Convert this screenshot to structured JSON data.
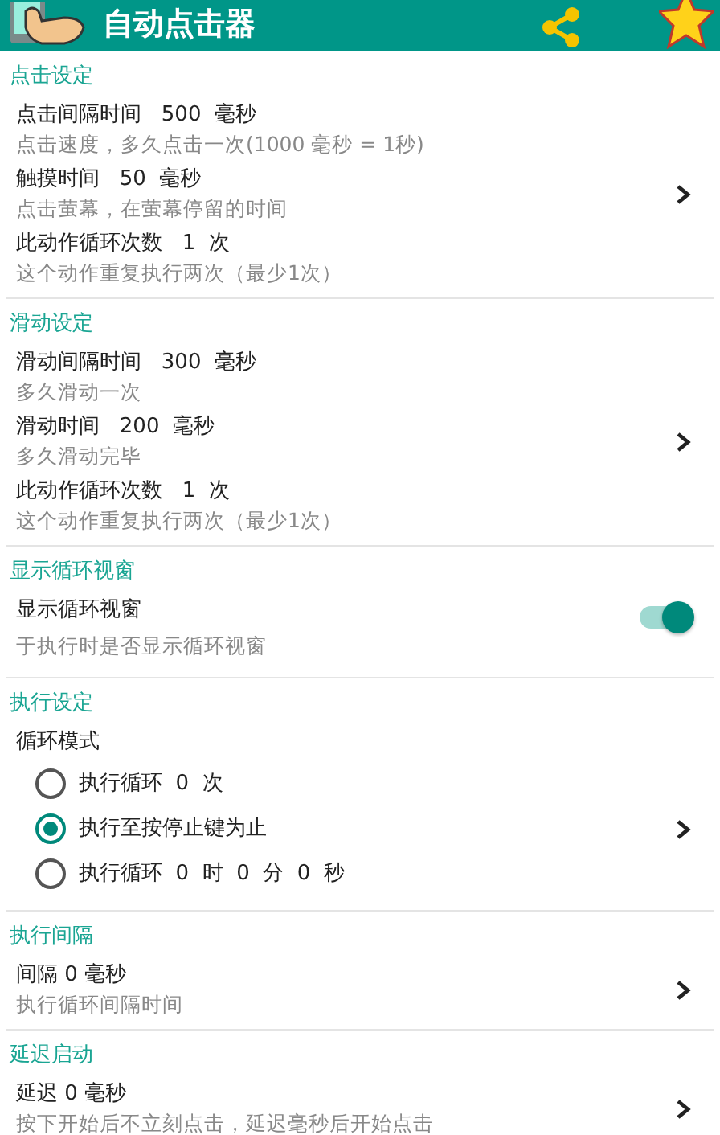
{
  "app_bar": {
    "title": "自动点击器"
  },
  "sections": [
    {
      "kind": "group",
      "header": "点击设定",
      "items": [
        {
          "title": "点击间隔时间   500  毫秒",
          "subtitle": "点击速度，多久点击一次(1000 毫秒 = 1秒)"
        },
        {
          "title": "触摸时间   50  毫秒",
          "subtitle": "点击萤幕，在萤幕停留的时间"
        },
        {
          "title": "此动作循环次数   1  次",
          "subtitle": "这个动作重复执行两次（最少1次）"
        }
      ]
    },
    {
      "kind": "group",
      "header": "滑动设定",
      "items": [
        {
          "title": "滑动间隔时间   300  毫秒",
          "subtitle": "多久滑动一次"
        },
        {
          "title": "滑动时间   200  毫秒",
          "subtitle": "多久滑动完毕"
        },
        {
          "title": "此动作循环次数   1  次",
          "subtitle": "这个动作重复执行两次（最少1次）"
        }
      ]
    },
    {
      "kind": "toggle",
      "header": "显示循环视窗",
      "title": "显示循环视窗",
      "subtitle": "于执行时是否显示循环视窗",
      "on": true
    },
    {
      "kind": "radio",
      "header": "执行设定",
      "title": "循环模式",
      "options": [
        {
          "label": "执行循环  0  次",
          "selected": false
        },
        {
          "label": "执行至按停止键为止",
          "selected": true
        },
        {
          "label": "执行循环  0  时  0  分  0  秒",
          "selected": false
        }
      ]
    },
    {
      "kind": "group",
      "header": "执行间隔",
      "items": [
        {
          "title": "间隔 0 毫秒",
          "subtitle": "执行循环间隔时间"
        }
      ]
    },
    {
      "kind": "group",
      "header": "延迟启动",
      "items": [
        {
          "title": "延迟 0 毫秒",
          "subtitle": "按下开始后不立刻点击，延迟毫秒后开始点击"
        }
      ]
    }
  ]
}
